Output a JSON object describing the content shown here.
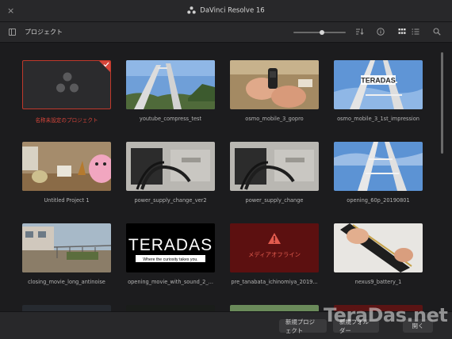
{
  "window": {
    "title": "DaVinci Resolve 16",
    "close_glyph": "×"
  },
  "toolbar": {
    "label": "プロジェクト",
    "zoom_level": 0.55,
    "icons": [
      "panel-toggle-icon",
      "sort-icon",
      "info-icon",
      "grid-view-icon",
      "list-view-icon",
      "search-icon"
    ]
  },
  "projects": [
    {
      "name": "名称未設定のプロジェクト",
      "thumb": "davinci-placeholder",
      "selected": true
    },
    {
      "name": "youtube_compress_test",
      "thumb": "tower-sky-trees"
    },
    {
      "name": "osmo_mobile_3_gopro",
      "thumb": "hands-gimbal"
    },
    {
      "name": "osmo_mobile_3_1st_impression",
      "thumb": "tower-title-teradas"
    },
    {
      "name": "Untitled Project 1",
      "thumb": "room-toys"
    },
    {
      "name": "power_supply_change_ver2",
      "thumb": "pc-interior"
    },
    {
      "name": "power_supply_change",
      "thumb": "pc-interior"
    },
    {
      "name": "opening_60p_20190801",
      "thumb": "tower-sky"
    },
    {
      "name": "closing_movie_long_antinoise",
      "thumb": "construction-site"
    },
    {
      "name": "opening_movie_with_sound_2_...",
      "thumb": "teradas-logo"
    },
    {
      "name": "pre_tanabata_ichinomiya_2019...",
      "thumb": "media-offline"
    },
    {
      "name": "nexus9_battery_1",
      "thumb": "hands-battery"
    }
  ],
  "thumb_text": {
    "teradas": "TERADAS",
    "teradas_small": "TERADAS",
    "tagline": "Where the curiosity takes you.",
    "media_offline": "メディアオフライン"
  },
  "bottombar": {
    "new_project": "新規プロジェクト",
    "new_folder": "新規フォルダー",
    "open": "開く"
  },
  "watermark": "TeraDas.net",
  "colors": {
    "accent_red": "#d6453a",
    "background": "#1c1c1e",
    "panel": "#28282a"
  }
}
